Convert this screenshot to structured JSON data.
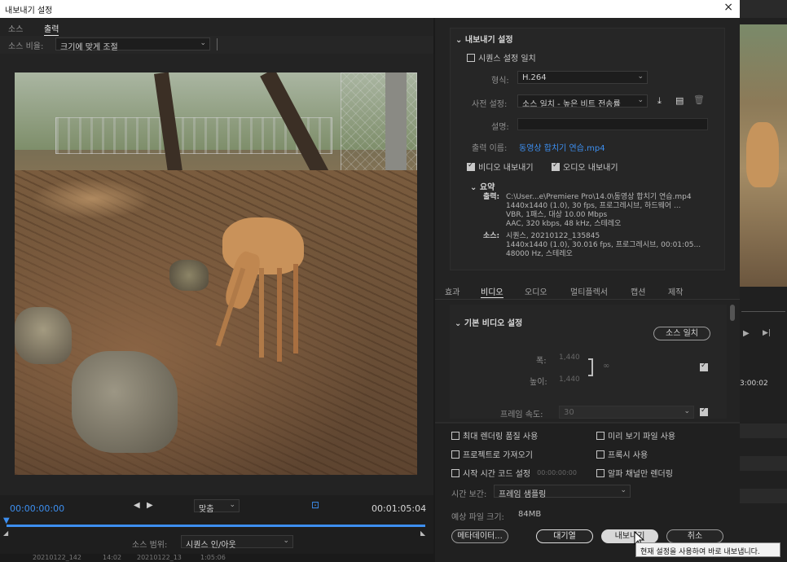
{
  "window": {
    "title": "내보내기 설정",
    "close": "×"
  },
  "left": {
    "tabs": [
      "소스",
      "출력"
    ],
    "scale_label": "소스 비율:",
    "scale_value": "크기에 맞게 조절",
    "timecode_start": "00:00:00:00",
    "timecode_end": "00:01:05:04",
    "fit_value": "맞춤",
    "range_label": "소스 범위:",
    "range_value": "시퀀스 인/아웃",
    "bottom_strip": [
      "20210122_142",
      "14:02",
      "20210122_13",
      "1:05:06"
    ]
  },
  "export": {
    "heading": "내보내기 설정",
    "match_sequence": "시퀀스 설정 일치",
    "format_label": "형식:",
    "format_value": "H.264",
    "preset_label": "사전 설정:",
    "preset_value": "소스 일치 - 높은 비트 전송률",
    "comment_label": "설명:",
    "output_name_label": "출력 이름:",
    "output_name_value": "동영상 합치기 연습.mp4",
    "export_video": "비디오 내보내기",
    "export_audio": "오디오 내보내기",
    "summary_heading": "요약",
    "output_key": "출력:",
    "output_lines": [
      "C:\\User...e\\Premiere Pro\\14.0\\동영상 합치기 연습.mp4",
      "1440x1440 (1.0), 30 fps, 프로그레시브, 하드웨어 ...",
      "VBR, 1패스, 대상 10.00 Mbps",
      "AAC, 320 kbps, 48 kHz, 스테레오"
    ],
    "source_key": "소스:",
    "source_lines": [
      "시퀀스, 20210122_135845",
      "1440x1440 (1.0), 30.016 fps, 프로그레시브, 00:01:05...",
      "48000 Hz, 스테레오"
    ]
  },
  "tabs2": [
    "효과",
    "비디오",
    "오디오",
    "멀티플렉서",
    "캡션",
    "제작"
  ],
  "video": {
    "heading": "기본 비디오 설정",
    "match_source": "소스 일치",
    "width_label": "폭:",
    "width_value": "1,440",
    "height_label": "높이:",
    "height_value": "1,440",
    "framerate_label": "프레임 속도:",
    "framerate_value": "30"
  },
  "options": {
    "max_render": "최대 렌더링 품질 사용",
    "use_previews": "미리 보기 파일 사용",
    "import_project": "프로젝트로 가져오기",
    "use_proxies": "프록시 사용",
    "start_timecode": "시작 시간 코드 설정",
    "start_timecode_value": "00:00:00:00",
    "alpha_only": "알파 채널만 렌더링",
    "interp_label": "시간 보간:",
    "interp_value": "프레임 샘플링",
    "filesize_label": "예상 파일 크기:",
    "filesize_value": "84MB"
  },
  "buttons": {
    "metadata": "메타데이터...",
    "queue": "대기열",
    "export": "내보내기",
    "cancel": "취소"
  },
  "tooltip": "현재 설정을 사용하여 바로 내보냅니다.",
  "bg_timecode": "3:00:02"
}
